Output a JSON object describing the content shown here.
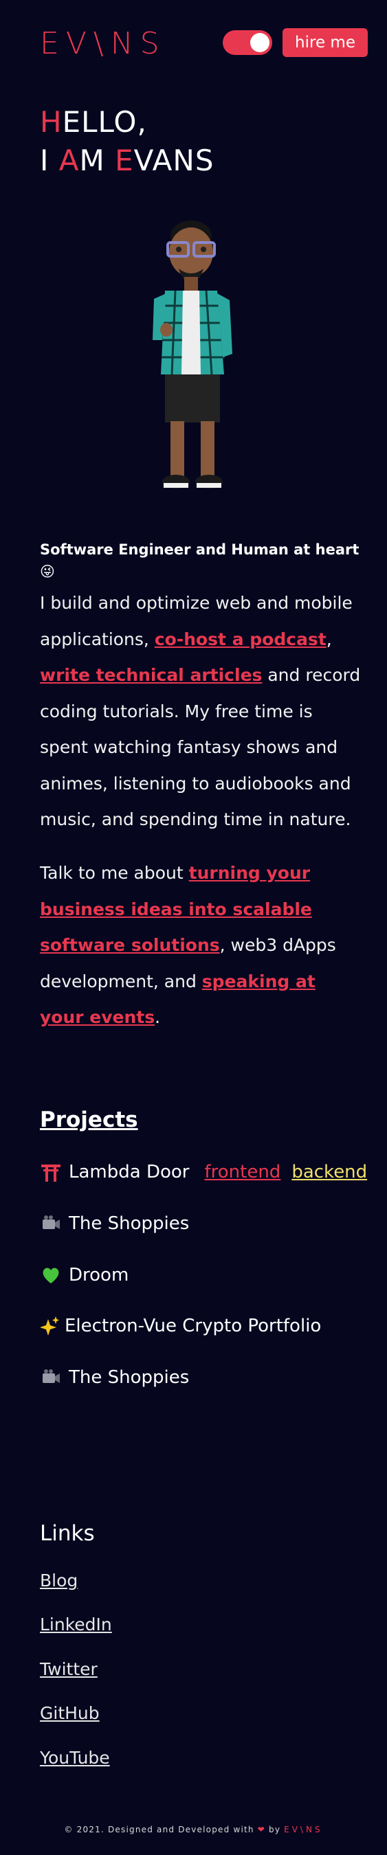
{
  "header": {
    "logo": "EV\\NS",
    "theme_toggle": "on",
    "hire_label": "hire me"
  },
  "hero": {
    "line1_first": "H",
    "line1_rest": "ELLO,",
    "line2_a": "I ",
    "line2_b": "A",
    "line2_c": "M ",
    "line2_d": "E",
    "line2_e": "VANS"
  },
  "tagline": "Software Engineer and Human at heart 😜",
  "about": {
    "p1_t1": "I build and optimize web and mobile applications, ",
    "p1_l1": "co-host a podcast",
    "p1_t2": ", ",
    "p1_l2": "write technical articles",
    "p1_t3": " and record coding tutorials. My free time is spent watching fantasy shows and animes, listening to audiobooks and music, and spending time in nature.",
    "p2_t1": "Talk to me about ",
    "p2_l1": "turning your business ideas into scalable software solutions",
    "p2_t2": ", web3 dApps development, and ",
    "p2_l2": "speaking at your events",
    "p2_t3": "."
  },
  "projects": {
    "title": "Projects",
    "items": [
      {
        "icon": "torii-gate-icon",
        "emoji": "⛩️",
        "name": "Lambda Door",
        "link1": "frontend",
        "link2": "backend"
      },
      {
        "icon": "video-camera-icon",
        "emoji": "📹",
        "name": "The Shoppies"
      },
      {
        "icon": "green-heart-icon",
        "emoji": "💚",
        "name": "Droom"
      },
      {
        "icon": "sparkles-icon",
        "emoji": "✨",
        "name": "Electron-Vue Crypto Portfolio"
      },
      {
        "icon": "video-camera-icon",
        "emoji": "📹",
        "name": "The Shoppies"
      }
    ]
  },
  "links": {
    "title": "Links",
    "items": [
      "Blog",
      "LinkedIn",
      "Twitter",
      "GitHub",
      "YouTube"
    ]
  },
  "footer": {
    "text": "© 2021. Designed and Developed with ",
    "heart": "❤",
    "by": " by ",
    "brand": "EV\\NS"
  },
  "colors": {
    "background": "#06061f",
    "accent": "#e8384f",
    "secondary_link": "#f0e06a"
  }
}
